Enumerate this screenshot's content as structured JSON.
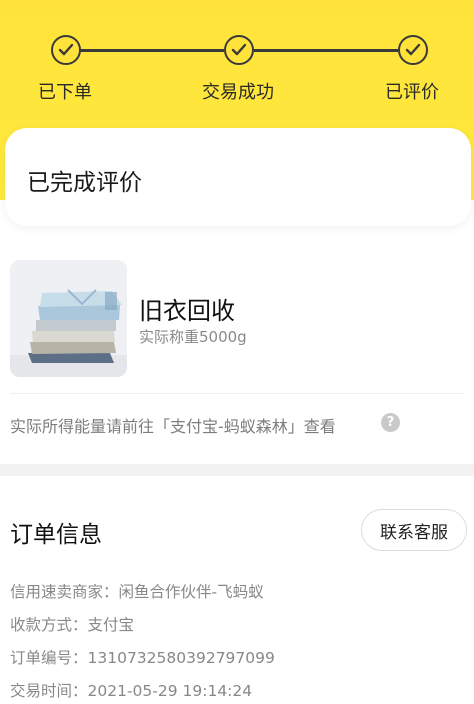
{
  "progress": {
    "steps": [
      {
        "label": "已下单"
      },
      {
        "label": "交易成功"
      },
      {
        "label": "已评价"
      }
    ]
  },
  "status": {
    "text": "已完成评价"
  },
  "product": {
    "title": "旧衣回收",
    "weight": "实际称重5000g",
    "image_icon": "folded-clothes-image"
  },
  "energy": {
    "text": "实际所得能量请前往「支付宝-蚂蚁森林」查看",
    "help_icon": "?"
  },
  "order": {
    "title": "订单信息",
    "contact_button": "联系客服",
    "rows": [
      "信用速卖商家：闲鱼合作伙伴-飞蚂蚁",
      "收款方式：支付宝",
      "订单编号：1310732580392797099",
      "交易时间：2021-05-29 19:14:24"
    ]
  },
  "colors": {
    "header_yellow": "#ffe33b",
    "line_dark": "#3a3a3a"
  }
}
